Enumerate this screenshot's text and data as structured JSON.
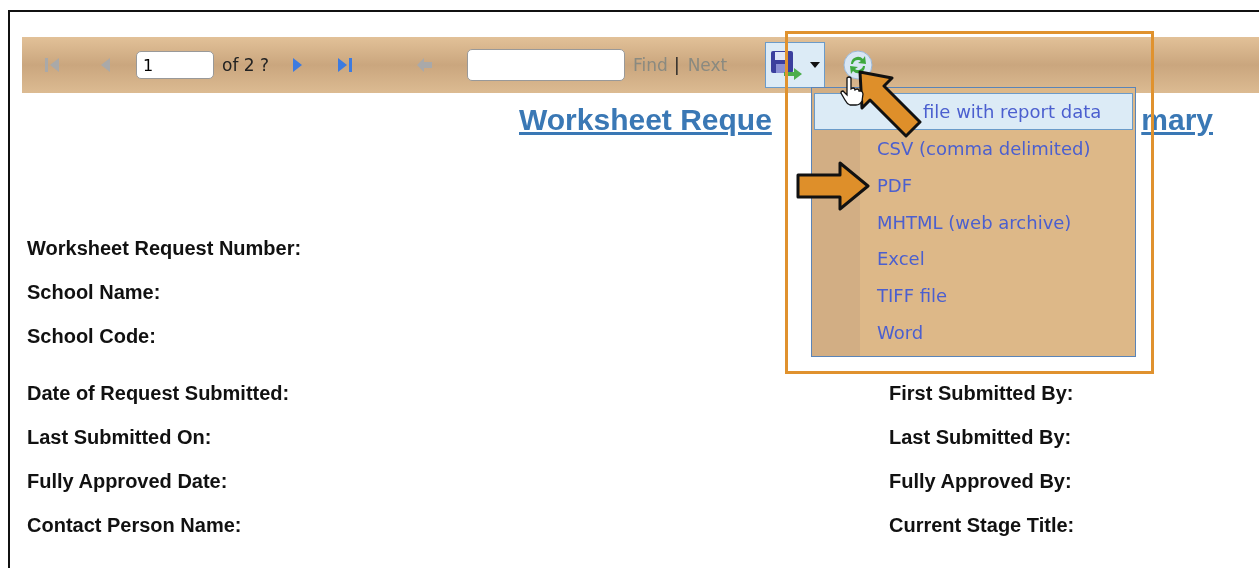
{
  "toolbar": {
    "nav_buttons": [
      {
        "kind": "first",
        "disabled": true
      },
      {
        "kind": "previous",
        "disabled": true
      }
    ],
    "page_input": {
      "value": "1"
    },
    "page_count": "of 2 ?",
    "nav_buttons_after": [
      {
        "kind": "next",
        "disabled": false
      },
      {
        "kind": "last",
        "disabled": false
      },
      {
        "kind": "back",
        "disabled": true
      }
    ],
    "find_link": {
      "label": "Find",
      "disabled": true
    },
    "separator": "|",
    "next_link": {
      "label": "Next",
      "disabled": true
    },
    "export_button": {
      "expanded": true
    }
  },
  "title_parts": [
    "Worksheet Reque",
    "mary"
  ],
  "export_menu": [
    {
      "label": "file with report data",
      "selected": true
    },
    {
      "label": "CSV (comma delimited)",
      "selected": false
    },
    {
      "label": "PDF",
      "selected": false
    },
    {
      "label": "MHTML (web archive)",
      "selected": false
    },
    {
      "label": "Excel",
      "selected": false
    },
    {
      "label": "TIFF file",
      "selected": false
    },
    {
      "label": "Word",
      "selected": false
    }
  ],
  "fields_top": [
    "Worksheet Request Number:",
    "School Name:",
    "School Code:"
  ],
  "fields_left": [
    "Date of Request Submitted:",
    "Last Submitted On:",
    "Fully Approved Date:",
    "Contact Person Name:"
  ],
  "fields_right": [
    "First Submitted By:",
    "Last Submitted By:",
    "Fully Approved By:",
    "Current Stage Title:"
  ]
}
